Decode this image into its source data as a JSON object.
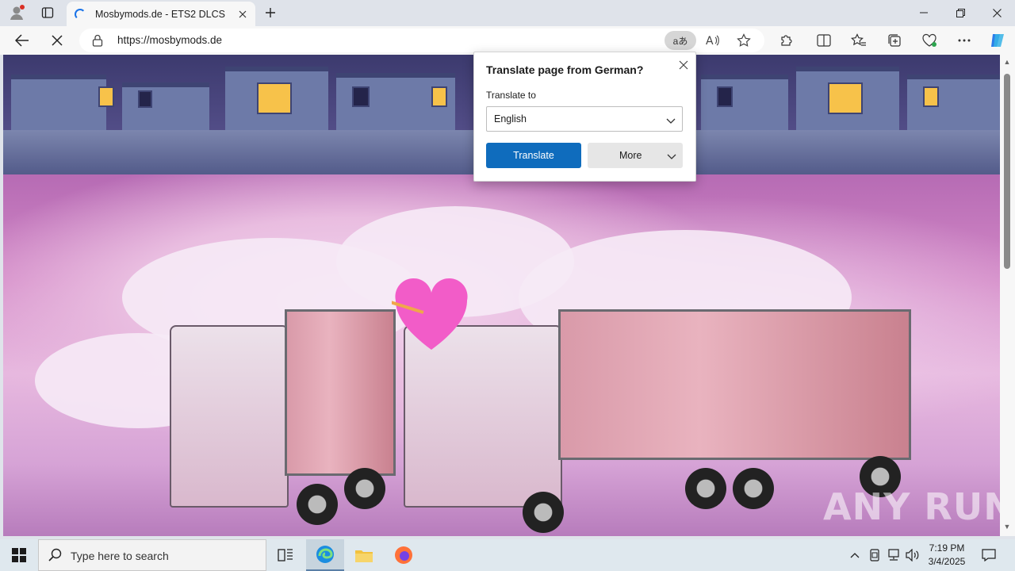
{
  "browser": {
    "tab": {
      "title": "Mosbymods.de - ETS2 DLCS"
    },
    "address": {
      "url": "https://mosbymods.de"
    },
    "translate_pill_glyph": "aあ"
  },
  "popup": {
    "title": "Translate page from German?",
    "label": "Translate to",
    "selected_language": "English",
    "translate_button": "Translate",
    "more_button": "More"
  },
  "page": {
    "watermark": "ANY RUN"
  },
  "taskbar": {
    "search_placeholder": "Type here to search",
    "clock_time": "7:19 PM",
    "clock_date": "3/4/2025"
  },
  "colors": {
    "accent": "#0f6cbd",
    "tab_bg": "#f7f7f7",
    "chrome_bg": "#dfe3ea"
  }
}
